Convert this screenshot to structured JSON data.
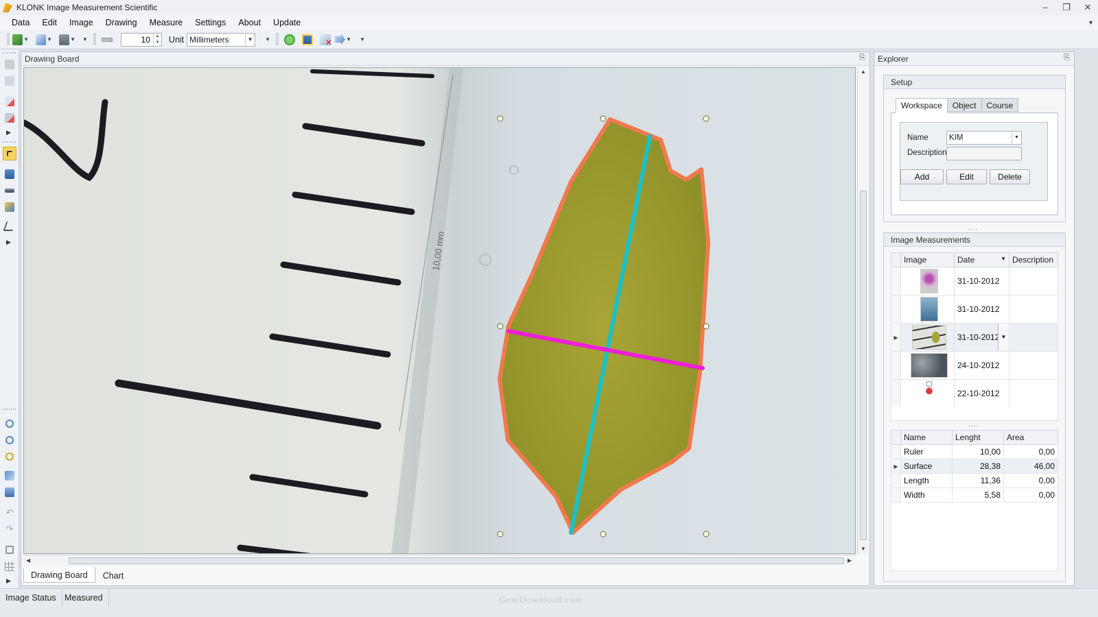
{
  "window": {
    "title": "KLONK Image Measurement Scientific"
  },
  "menu": [
    "Data",
    "Edit",
    "Image",
    "Drawing",
    "Measure",
    "Settings",
    "About",
    "Update"
  ],
  "toolbar": {
    "ruler_value": "10",
    "unit_label": "Unit",
    "unit_value": "Millimeters"
  },
  "drawing_board": {
    "caption": "Drawing Board",
    "ruler_annotation": "10,00 mm",
    "tabs": [
      "Drawing Board",
      "Chart"
    ],
    "colors": {
      "outline": "#f07a4e",
      "length_line": "#19c2c9",
      "width_line": "#ee1fd6"
    }
  },
  "explorer": {
    "caption": "Explorer",
    "setup": {
      "caption": "Setup",
      "tabs": [
        "Workspace",
        "Object",
        "Course"
      ],
      "name_label": "Name",
      "name_value": "KIM",
      "description_label": "Description",
      "description_value": "",
      "buttons": {
        "add": "Add",
        "edit": "Edit",
        "delete": "Delete"
      }
    },
    "image_measurements": {
      "caption": "Image Measurements",
      "columns": [
        "Image",
        "Date",
        "Description"
      ],
      "rows": [
        {
          "date": "31-10-2012",
          "description": "",
          "thumb": "purple-flower"
        },
        {
          "date": "31-10-2012",
          "description": "",
          "thumb": "blue-scene"
        },
        {
          "date": "31-10-2012",
          "description": "",
          "thumb": "leaf-ruler"
        },
        {
          "date": "24-10-2012",
          "description": "",
          "thumb": "gray-texture"
        },
        {
          "date": "22-10-2012",
          "description": "",
          "thumb": "human-figure"
        }
      ]
    },
    "measurements": {
      "columns": [
        "Name",
        "Lenght",
        "Area"
      ],
      "rows": [
        {
          "name": "Ruler",
          "length": "10,00",
          "area": "0,00"
        },
        {
          "name": "Surface",
          "length": "28,38",
          "area": "46,00"
        },
        {
          "name": "Length",
          "length": "11,36",
          "area": "0,00"
        },
        {
          "name": "Width",
          "length": "5,58",
          "area": "0,00"
        }
      ]
    }
  },
  "status": {
    "item1": "Image Status",
    "item2": "Measured",
    "watermark": "GearDownload.com"
  }
}
